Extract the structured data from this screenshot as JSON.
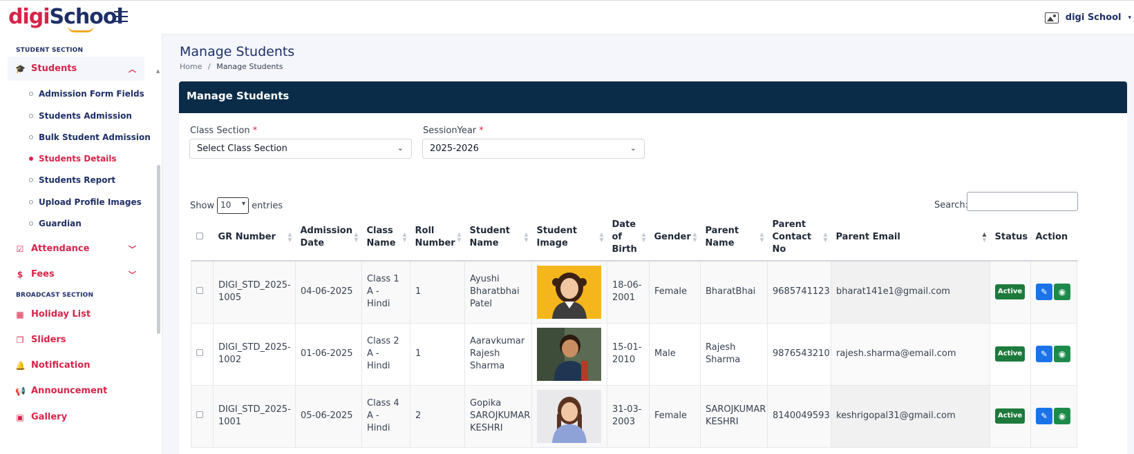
{
  "app": {
    "logo_part1": "digi",
    "logo_part2": "School",
    "user_name": "digi School"
  },
  "sidebar": {
    "section_student": "STUDENT SECTION",
    "students": "Students",
    "sub_items": [
      "Admission Form Fields",
      "Students Admission",
      "Bulk Student Admission",
      "Students Details",
      "Students Report",
      "Upload Profile Images",
      "Guardian"
    ],
    "attendance": "Attendance",
    "fees": "Fees",
    "section_broadcast": "BROADCAST SECTION",
    "holiday_list": "Holiday List",
    "sliders": "Sliders",
    "notification": "Notification",
    "announcement": "Announcement",
    "gallery": "Gallery"
  },
  "page": {
    "title": "Manage Students",
    "breadcrumb_home": "Home",
    "breadcrumb_sep": "/",
    "breadcrumb_current": "Manage Students",
    "card_title": "Manage Students"
  },
  "filters": {
    "class_section_label": "Class Section",
    "class_section_value": "Select Class Section",
    "session_year_label": "SessionYear",
    "session_year_value": "2025-2026",
    "required_mark": "*"
  },
  "table_controls": {
    "show": "Show",
    "entries_value": "10",
    "entries": "entries",
    "search_label": "Search:"
  },
  "table": {
    "headers": {
      "gr_number": "GR Number",
      "admission_date": "Admission Date",
      "class_name": "Class Name",
      "roll_number": "Roll Number",
      "student_name": "Student Name",
      "student_image": "Student Image",
      "dob": "Date of Birth",
      "gender": "Gender",
      "parent_name": "Parent Name",
      "parent_contact": "Parent Contact No",
      "parent_email": "Parent Email",
      "status": "Status",
      "action": "Action"
    },
    "rows": [
      {
        "gr_number": "DIGI_STD_2025-1005",
        "admission_date": "04-06-2025",
        "class_name": "Class 1 A - Hindi",
        "roll_number": "1",
        "student_name": "Ayushi Bharatbhai Patel",
        "dob": "18-06-2001",
        "gender": "Female",
        "parent_name": "BharatBhai",
        "parent_contact": "9685741123",
        "parent_email": "bharat141e1@gmail.com",
        "status": "Active"
      },
      {
        "gr_number": "DIGI_STD_2025-1002",
        "admission_date": "01-06-2025",
        "class_name": "Class 2 A - Hindi",
        "roll_number": "1",
        "student_name": "Aaravkumar Rajesh Sharma",
        "dob": "15-01-2010",
        "gender": "Male",
        "parent_name": "Rajesh Sharma",
        "parent_contact": "9876543210",
        "parent_email": "rajesh.sharma@email.com",
        "status": "Active"
      },
      {
        "gr_number": "DIGI_STD_2025-1001",
        "admission_date": "05-06-2025",
        "class_name": "Class 4 A - Hindi",
        "roll_number": "2",
        "student_name": "Gopika SAROJKUMAR KESHRI",
        "dob": "31-03-2003",
        "gender": "Female",
        "parent_name": "SAROJKUMAR KESHRI",
        "parent_contact": "8140049593",
        "parent_email": "keshrigopal31@gmail.com",
        "status": "Active"
      }
    ]
  },
  "colors": {
    "brand_red": "#d6244a",
    "brand_navy": "#1e2f66",
    "card_header": "#0b2c48",
    "active_badge": "#1d7a3c",
    "edit_button": "#1a73e8",
    "view_button": "#1d8a4a"
  }
}
